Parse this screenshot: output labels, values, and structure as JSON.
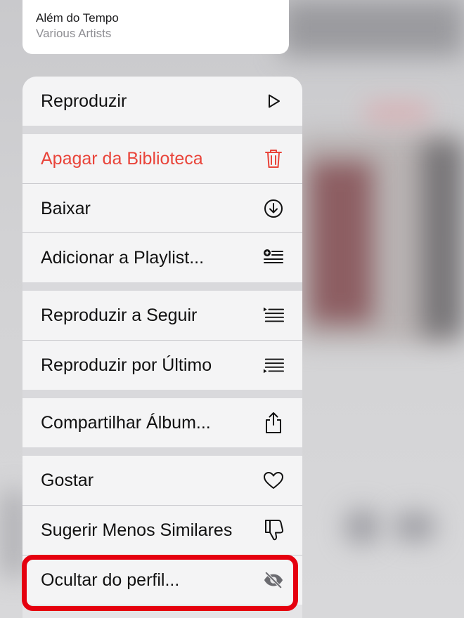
{
  "preview": {
    "title": "Além do Tempo",
    "subtitle": "Various Artists"
  },
  "menu": {
    "items": [
      {
        "label": "Reproduzir",
        "icon": "play-icon"
      },
      {
        "label": "Apagar da Biblioteca",
        "icon": "trash-icon",
        "color": "#e9443a"
      },
      {
        "label": "Baixar",
        "icon": "download-icon"
      },
      {
        "label": "Adicionar a Playlist...",
        "icon": "add-to-playlist-icon"
      },
      {
        "label": "Reproduzir a Seguir",
        "icon": "play-next-icon"
      },
      {
        "label": "Reproduzir por Último",
        "icon": "play-last-icon"
      },
      {
        "label": "Compartilhar Álbum...",
        "icon": "share-icon"
      },
      {
        "label": "Gostar",
        "icon": "heart-icon"
      },
      {
        "label": "Sugerir Menos Similares",
        "icon": "thumbs-down-icon"
      },
      {
        "label": "Ocultar do perfil...",
        "icon": "eye-slash-icon"
      }
    ]
  },
  "highlight_color": "#e5000f"
}
